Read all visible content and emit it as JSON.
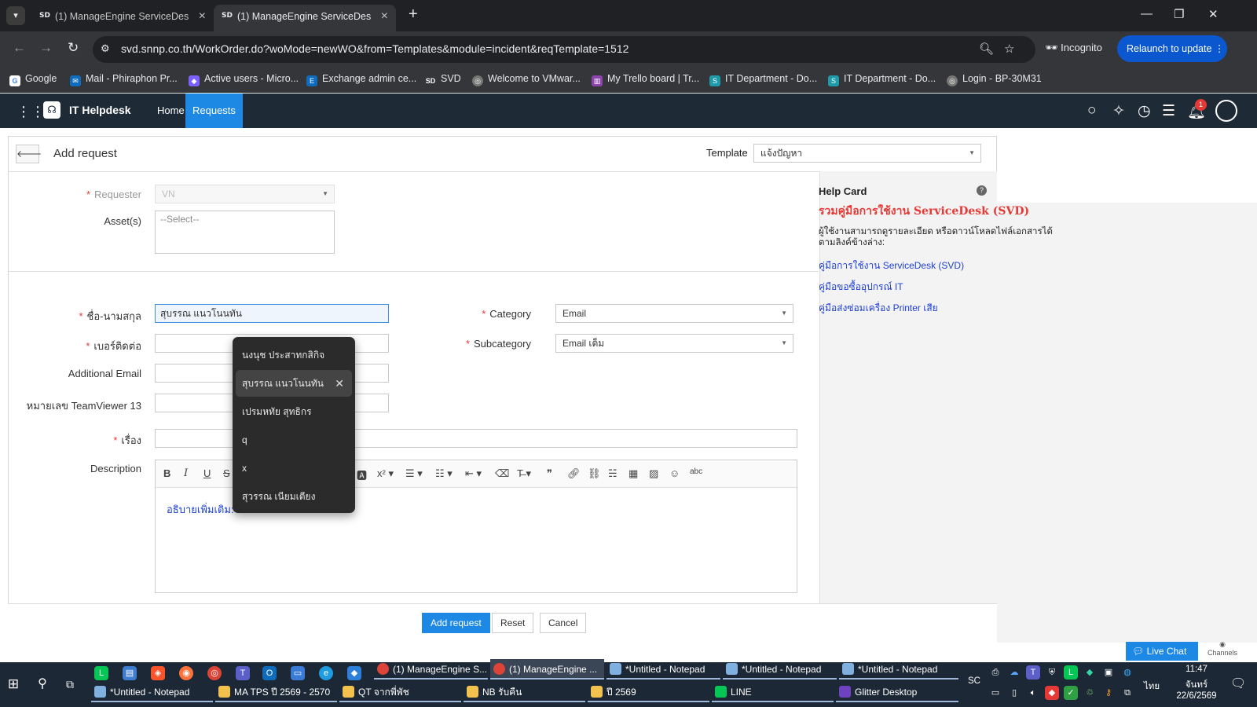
{
  "browser": {
    "tabs": [
      {
        "favicon": "SD",
        "title": "(1) ManageEngine ServiceDesk",
        "active": false
      },
      {
        "favicon": "SD",
        "title": "(1) ManageEngine ServiceDesk",
        "active": true
      }
    ],
    "url": "svd.snnp.co.th/WorkOrder.do?woMode=newWO&from=Templates&module=incident&reqTemplate=1512",
    "incognito_label": "Incognito",
    "relaunch_label": "Relaunch to update",
    "bookmarks": [
      {
        "label": "Google",
        "color": "#4285f4"
      },
      {
        "label": "Mail - Phiraphon Pr...",
        "color": "#0f6cbd"
      },
      {
        "label": "Active users - Micro...",
        "color": "#7b61ff"
      },
      {
        "label": "Exchange admin ce...",
        "color": "#0f6cbd"
      },
      {
        "label": "SVD",
        "color": "#35363a"
      },
      {
        "label": "Welcome to VMwar...",
        "color": "#777777"
      },
      {
        "label": "My Trello board | Tr...",
        "color": "#8e44ad"
      },
      {
        "label": "IT Department - Do...",
        "color": "#1f9aa8"
      },
      {
        "label": "IT Department - Do...",
        "color": "#1f9aa8"
      },
      {
        "label": "Login - BP-30M31",
        "color": "#777777"
      }
    ]
  },
  "app": {
    "name": "IT Helpdesk",
    "nav": [
      {
        "label": "Home",
        "active": false
      },
      {
        "label": "Requests",
        "active": true
      }
    ],
    "notification_count": "1"
  },
  "form": {
    "title": "Add request",
    "template_label": "Template",
    "template_value": "แจ้งปัญหา",
    "requester_label": "Requester",
    "requester_value": "VN",
    "assets_label": "Asset(s)",
    "assets_placeholder": "--Select--",
    "name_label": "ชื่อ-นามสกุล",
    "name_value": "สุบรรณ แนวโนนทัน",
    "phone_label": "เบอร์ติดต่อ",
    "email_label": "Additional Email",
    "teamviewer_label": "หมายเลข TeamViewer 13",
    "subject_label": "เรื่อง",
    "description_label": "Description",
    "description_value": "อธิบายเพิ่มเติม:",
    "category_label": "Category",
    "category_value": "Email",
    "subcategory_label": "Subcategory",
    "subcategory_value": "Email เต็ม",
    "buttons": {
      "add": "Add request",
      "reset": "Reset",
      "cancel": "Cancel"
    }
  },
  "autocomplete": [
    "นงนุช ประสาทกสิกิจ",
    "สุบรรณ  แนวโนนทัน",
    "เปรมหทัย สุทธิกร",
    "q",
    "x",
    "สุวรรณ เนียมเตียง"
  ],
  "help_card": {
    "title": "Help Card",
    "heading": "รวมคู่มือการใช้งาน  ServiceDesk (SVD)",
    "description": "ผู้ใช้งานสามารถดูรายละเอียด หรือดาวน์โหลดไฟล์เอกสารได้ ตามลิงค์ข้างล่าง:",
    "links": [
      "คู่มือการใช้งาน ServiceDesk (SVD)",
      "คู่มือขอซื้ออุปกรณ์ IT",
      "คู่มือส่งซ่อมเครื่อง Printer เสีย"
    ]
  },
  "chat": {
    "live_chat": "Live Chat",
    "channels": "Channels"
  },
  "taskbar": {
    "row1": [
      {
        "label": "(1) ManageEngine S...",
        "color": "#db4437",
        "active": false
      },
      {
        "label": "(1) ManageEngine ...",
        "color": "#db4437",
        "active": true
      },
      {
        "label": "*Untitled - Notepad",
        "color": "#7fb0e0",
        "active": false
      },
      {
        "label": "*Untitled - Notepad",
        "color": "#7fb0e0",
        "active": false
      },
      {
        "label": "*Untitled - Notepad",
        "color": "#7fb0e0",
        "active": false
      }
    ],
    "row2": [
      {
        "label": "*Untitled - Notepad",
        "color": "#7fb0e0"
      },
      {
        "label": "MA TPS ปี 2569 - 2570",
        "color": "#f2c14e"
      },
      {
        "label": "QT จากพี่พัช",
        "color": "#f2c14e"
      },
      {
        "label": "NB รับคืน",
        "color": "#f2c14e"
      },
      {
        "label": "ปี 2569",
        "color": "#f2c14e"
      },
      {
        "label": "LINE",
        "color": "#06c755"
      },
      {
        "label": "Glitter Desktop",
        "color": "#6f42c1"
      }
    ],
    "lang_top": "SC",
    "lang": "ไทย",
    "time": "11:47",
    "day": "จันทร์",
    "date": "22/6/2569"
  }
}
